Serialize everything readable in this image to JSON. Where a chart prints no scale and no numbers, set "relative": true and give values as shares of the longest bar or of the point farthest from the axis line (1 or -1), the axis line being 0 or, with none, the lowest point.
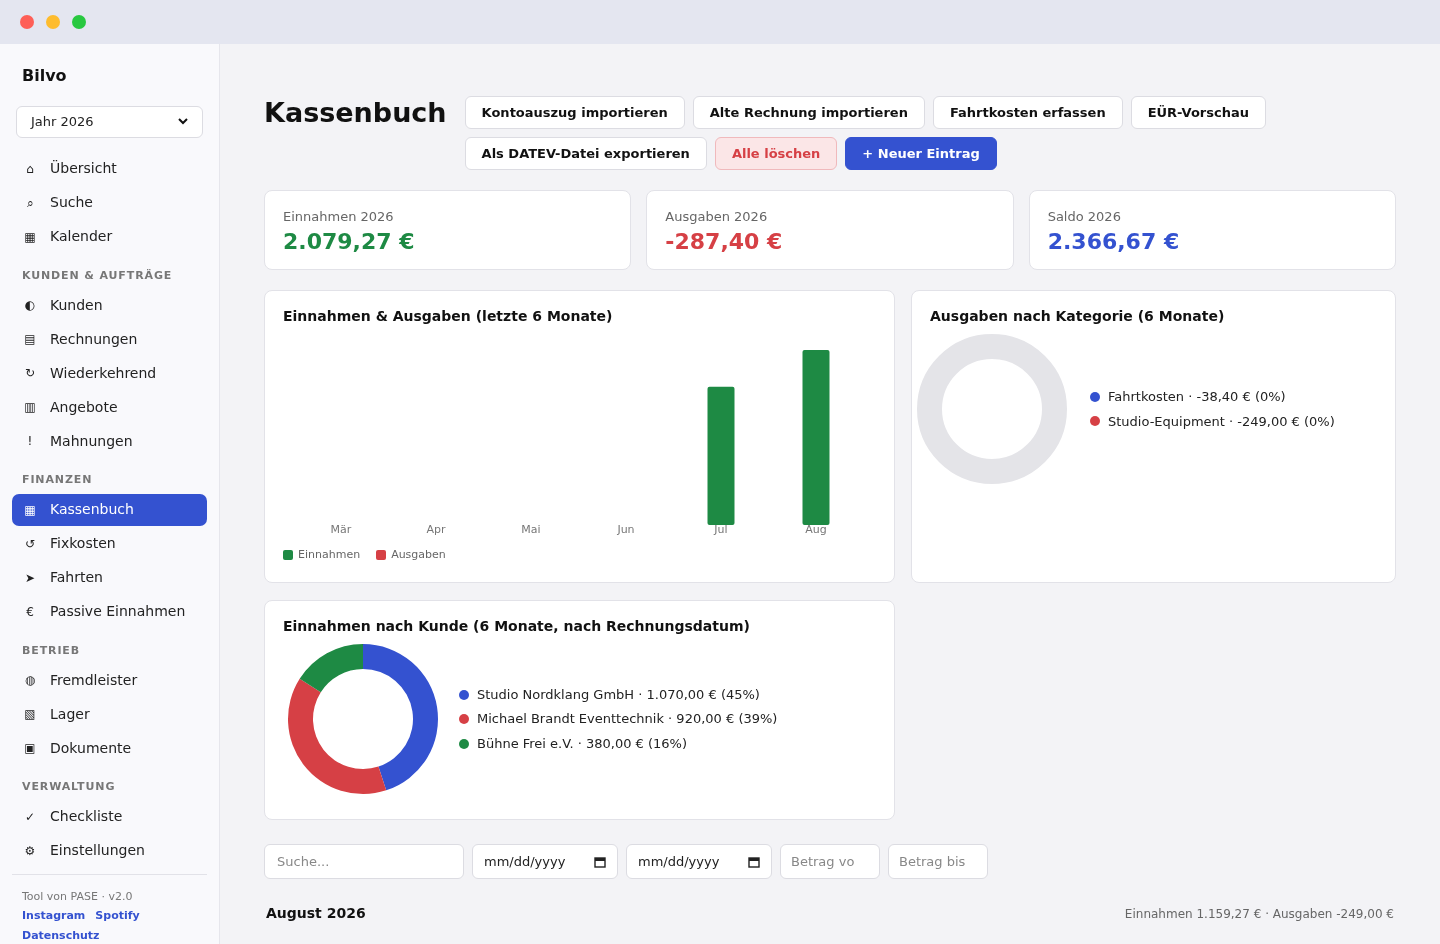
{
  "sidebar": {
    "brand": "Bilvo",
    "year_select": "Jahr 2026",
    "groups": [
      {
        "items": [
          {
            "icon": "⌂",
            "label": "Übersicht",
            "selected": false
          },
          {
            "icon": "⌕",
            "label": "Suche",
            "selected": false
          },
          {
            "icon": "▦",
            "label": "Kalender",
            "selected": false
          }
        ]
      },
      {
        "heading": "KUNDEN & AUFTRÄGE",
        "items": [
          {
            "icon": "◐",
            "label": "Kunden",
            "selected": false
          },
          {
            "icon": "▤",
            "label": "Rechnungen",
            "selected": false
          },
          {
            "icon": "↻",
            "label": "Wiederkehrend",
            "selected": false
          },
          {
            "icon": "▥",
            "label": "Angebote",
            "selected": false
          },
          {
            "icon": "!",
            "label": "Mahnungen",
            "selected": false
          }
        ]
      },
      {
        "heading": "FINANZEN",
        "items": [
          {
            "icon": "▦",
            "label": "Kassenbuch",
            "selected": true
          },
          {
            "icon": "↺",
            "label": "Fixkosten",
            "selected": false
          },
          {
            "icon": "➤",
            "label": "Fahrten",
            "selected": false
          },
          {
            "icon": "€",
            "label": "Passive Einnahmen",
            "selected": false
          }
        ]
      },
      {
        "heading": "BETRIEB",
        "items": [
          {
            "icon": "◍",
            "label": "Fremdleister",
            "selected": false
          },
          {
            "icon": "▧",
            "label": "Lager",
            "selected": false
          },
          {
            "icon": "▣",
            "label": "Dokumente",
            "selected": false
          }
        ]
      },
      {
        "heading": "VERWALTUNG",
        "items": [
          {
            "icon": "✓",
            "label": "Checkliste",
            "selected": false
          },
          {
            "icon": "⚙",
            "label": "Einstellungen",
            "selected": false
          }
        ]
      }
    ],
    "footer": {
      "text": "Tool von PASE · v2.0",
      "links": [
        "Instagram",
        "Spotify",
        "Datenschutz"
      ]
    }
  },
  "page": {
    "title": "Kassenbuch",
    "actions": [
      {
        "label": "Kontoauszug importieren",
        "kind": "default"
      },
      {
        "label": "Alte Rechnung importieren",
        "kind": "default"
      },
      {
        "label": "Fahrtkosten erfassen",
        "kind": "default"
      },
      {
        "label": "EÜR-Vorschau",
        "kind": "default"
      },
      {
        "label": "Als DATEV-Datei exportieren",
        "kind": "default"
      },
      {
        "label": "Alle löschen",
        "kind": "danger"
      },
      {
        "label": "+ Neuer Eintrag",
        "kind": "primary"
      }
    ]
  },
  "stats": [
    {
      "label": "Einnahmen 2026",
      "value": "2.079,27 €",
      "color": "#1e8a44"
    },
    {
      "label": "Ausgaben 2026",
      "value": "-287,40 €",
      "color": "#d64045"
    },
    {
      "label": "Saldo 2026",
      "value": "2.366,67 €",
      "color": "#3452d0"
    }
  ],
  "bar_panel": {
    "title": "Einnahmen & Ausgaben (letzte 6 Monate)",
    "chart_data": {
      "type": "bar",
      "relative": true,
      "categories": [
        "Mär",
        "Apr",
        "Mai",
        "Jun",
        "Jul",
        "Aug"
      ],
      "series": [
        {
          "name": "Einnahmen",
          "color": "#1e8a44",
          "values": [
            0,
            0,
            0,
            0,
            0.79,
            1
          ]
        },
        {
          "name": "Ausgaben",
          "color": "#d64045",
          "values": [
            0,
            0,
            0,
            0,
            0,
            0
          ]
        }
      ]
    }
  },
  "category_panel": {
    "title": "Ausgaben nach Kategorie (6 Monate)",
    "legend": [
      {
        "text": "Fahrtkosten · -38,40 € (0%)",
        "color": "#3452d0"
      },
      {
        "text": "Studio-Equipment · -249,00 € (0%)",
        "color": "#d64045"
      }
    ]
  },
  "customer_panel": {
    "title": "Einnahmen nach Kunde (6 Monate, nach Rechnungsdatum)",
    "chart_data": {
      "type": "donut",
      "categories": [
        "Studio Nordklang GmbH",
        "Michael Brandt Eventtechnik",
        "Bühne Frei e.V."
      ],
      "values": [
        45,
        39,
        16
      ]
    },
    "legend": [
      {
        "detail": "· 1.070,00 € (45%)",
        "color": "#3452d0"
      },
      {
        "detail": "· 920,00 € (39%)",
        "color": "#d64045"
      },
      {
        "detail": "· 380,00 € (16%)",
        "color": "#1e8a44"
      }
    ]
  },
  "filters": {
    "search": {
      "placeholder": "Suche..."
    },
    "date_from": {
      "placeholder": "mm/dd/yyyy"
    },
    "date_to": {
      "placeholder": "mm/dd/yyyy"
    },
    "amount_from": {
      "placeholder": "Betrag vo"
    },
    "amount_to": {
      "placeholder": "Betrag bis"
    }
  },
  "month": {
    "title": "August 2026",
    "summary": "Einnahmen 1.159,27 € · Ausgaben -249,00 €"
  }
}
